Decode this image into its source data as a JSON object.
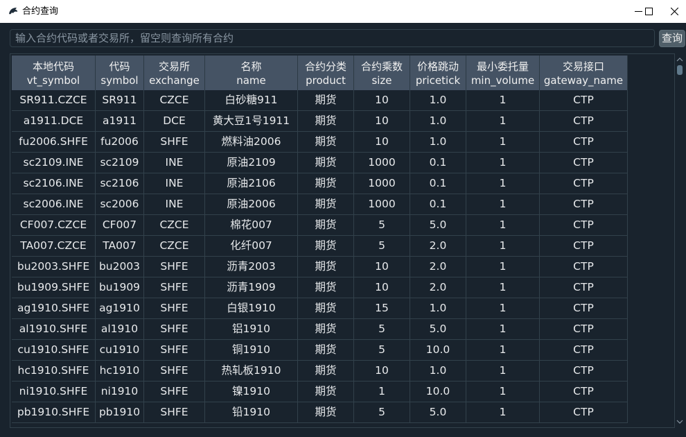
{
  "window": {
    "title": "合约查询",
    "icon": "app-logo-icon"
  },
  "search": {
    "placeholder": "输入合约代码或者交易所，留空则查询所有合约",
    "button_label": "查询"
  },
  "table": {
    "headers": [
      {
        "cn": "本地代码",
        "en": "vt_symbol"
      },
      {
        "cn": "代码",
        "en": "symbol"
      },
      {
        "cn": "交易所",
        "en": "exchange"
      },
      {
        "cn": "名称",
        "en": "name"
      },
      {
        "cn": "合约分类",
        "en": "product"
      },
      {
        "cn": "合约乘数",
        "en": "size"
      },
      {
        "cn": "价格跳动",
        "en": "pricetick"
      },
      {
        "cn": "最小委托量",
        "en": "min_volume"
      },
      {
        "cn": "交易接口",
        "en": "gateway_name"
      }
    ],
    "rows": [
      [
        "SR911.CZCE",
        "SR911",
        "CZCE",
        "白砂糖911",
        "期货",
        "10",
        "1.0",
        "1",
        "CTP"
      ],
      [
        "a1911.DCE",
        "a1911",
        "DCE",
        "黄大豆1号1911",
        "期货",
        "10",
        "1.0",
        "1",
        "CTP"
      ],
      [
        "fu2006.SHFE",
        "fu2006",
        "SHFE",
        "燃料油2006",
        "期货",
        "10",
        "1.0",
        "1",
        "CTP"
      ],
      [
        "sc2109.INE",
        "sc2109",
        "INE",
        "原油2109",
        "期货",
        "1000",
        "0.1",
        "1",
        "CTP"
      ],
      [
        "sc2106.INE",
        "sc2106",
        "INE",
        "原油2106",
        "期货",
        "1000",
        "0.1",
        "1",
        "CTP"
      ],
      [
        "sc2006.INE",
        "sc2006",
        "INE",
        "原油2006",
        "期货",
        "1000",
        "0.1",
        "1",
        "CTP"
      ],
      [
        "CF007.CZCE",
        "CF007",
        "CZCE",
        "棉花007",
        "期货",
        "5",
        "5.0",
        "1",
        "CTP"
      ],
      [
        "TA007.CZCE",
        "TA007",
        "CZCE",
        "化纤007",
        "期货",
        "5",
        "2.0",
        "1",
        "CTP"
      ],
      [
        "bu2003.SHFE",
        "bu2003",
        "SHFE",
        "沥青2003",
        "期货",
        "10",
        "2.0",
        "1",
        "CTP"
      ],
      [
        "bu1909.SHFE",
        "bu1909",
        "SHFE",
        "沥青1909",
        "期货",
        "10",
        "2.0",
        "1",
        "CTP"
      ],
      [
        "ag1910.SHFE",
        "ag1910",
        "SHFE",
        "白银1910",
        "期货",
        "15",
        "1.0",
        "1",
        "CTP"
      ],
      [
        "al1910.SHFE",
        "al1910",
        "SHFE",
        "铝1910",
        "期货",
        "5",
        "5.0",
        "1",
        "CTP"
      ],
      [
        "cu1910.SHFE",
        "cu1910",
        "SHFE",
        "铜1910",
        "期货",
        "5",
        "10.0",
        "1",
        "CTP"
      ],
      [
        "hc1910.SHFE",
        "hc1910",
        "SHFE",
        "热轧板1910",
        "期货",
        "10",
        "1.0",
        "1",
        "CTP"
      ],
      [
        "ni1910.SHFE",
        "ni1910",
        "SHFE",
        "镍1910",
        "期货",
        "1",
        "10.0",
        "1",
        "CTP"
      ],
      [
        "pb1910.SHFE",
        "pb1910",
        "SHFE",
        "铅1910",
        "期货",
        "5",
        "5.0",
        "1",
        "CTP"
      ]
    ]
  },
  "colors": {
    "background": "#19232d",
    "header": "#455364",
    "grid_line": "#32414b"
  }
}
